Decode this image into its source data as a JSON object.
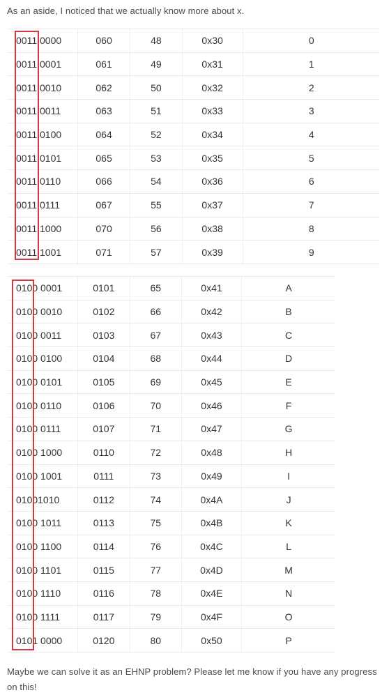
{
  "intro_text": "As an aside, I noticed that we actually know more about x.",
  "outro_text": "Maybe we can solve it as an EHNP problem? Please let me know if you have any progress on this!",
  "accent_color": "#d9363e",
  "table_digits": [
    [
      "0011 0000",
      "060",
      "48",
      "0x30",
      "0"
    ],
    [
      "0011 0001",
      "061",
      "49",
      "0x31",
      "1"
    ],
    [
      "0011 0010",
      "062",
      "50",
      "0x32",
      "2"
    ],
    [
      "0011 0011",
      "063",
      "51",
      "0x33",
      "3"
    ],
    [
      "0011 0100",
      "064",
      "52",
      "0x34",
      "4"
    ],
    [
      "0011 0101",
      "065",
      "53",
      "0x35",
      "5"
    ],
    [
      "0011 0110",
      "066",
      "54",
      "0x36",
      "6"
    ],
    [
      "0011 0111",
      "067",
      "55",
      "0x37",
      "7"
    ],
    [
      "0011 1000",
      "070",
      "56",
      "0x38",
      "8"
    ],
    [
      "0011 1001",
      "071",
      "57",
      "0x39",
      "9"
    ]
  ],
  "table_letters": [
    [
      "0100 0001",
      "0101",
      "65",
      "0x41",
      "A"
    ],
    [
      "0100 0010",
      "0102",
      "66",
      "0x42",
      "B"
    ],
    [
      "0100 0011",
      "0103",
      "67",
      "0x43",
      "C"
    ],
    [
      "0100 0100",
      "0104",
      "68",
      "0x44",
      "D"
    ],
    [
      "0100 0101",
      "0105",
      "69",
      "0x45",
      "E"
    ],
    [
      "0100 0110",
      "0106",
      "70",
      "0x46",
      "F"
    ],
    [
      "0100 0111",
      "0107",
      "71",
      "0x47",
      "G"
    ],
    [
      "0100 1000",
      "0110",
      "72",
      "0x48",
      "H"
    ],
    [
      "0100 1001",
      "0111",
      "73",
      "0x49",
      "I"
    ],
    [
      "01001010",
      "0112",
      "74",
      "0x4A",
      "J"
    ],
    [
      "0100 1011",
      "0113",
      "75",
      "0x4B",
      "K"
    ],
    [
      "0100 1100",
      "0114",
      "76",
      "0x4C",
      "L"
    ],
    [
      "0100 1101",
      "0115",
      "77",
      "0x4D",
      "M"
    ],
    [
      "0100 1110",
      "0116",
      "78",
      "0x4E",
      "N"
    ],
    [
      "0100 1111",
      "0117",
      "79",
      "0x4F",
      "O"
    ],
    [
      "0101 0000",
      "0120",
      "80",
      "0x50",
      "P"
    ]
  ]
}
